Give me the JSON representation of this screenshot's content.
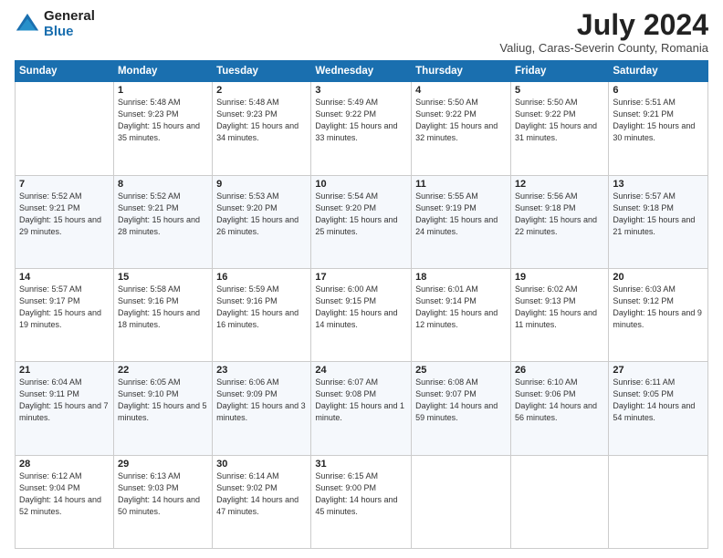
{
  "logo": {
    "general": "General",
    "blue": "Blue"
  },
  "header": {
    "title": "July 2024",
    "subtitle": "Valiug, Caras-Severin County, Romania"
  },
  "weekdays": [
    "Sunday",
    "Monday",
    "Tuesday",
    "Wednesday",
    "Thursday",
    "Friday",
    "Saturday"
  ],
  "weeks": [
    [
      {
        "day": "",
        "sunrise": "",
        "sunset": "",
        "daylight": ""
      },
      {
        "day": "1",
        "sunrise": "Sunrise: 5:48 AM",
        "sunset": "Sunset: 9:23 PM",
        "daylight": "Daylight: 15 hours and 35 minutes."
      },
      {
        "day": "2",
        "sunrise": "Sunrise: 5:48 AM",
        "sunset": "Sunset: 9:23 PM",
        "daylight": "Daylight: 15 hours and 34 minutes."
      },
      {
        "day": "3",
        "sunrise": "Sunrise: 5:49 AM",
        "sunset": "Sunset: 9:22 PM",
        "daylight": "Daylight: 15 hours and 33 minutes."
      },
      {
        "day": "4",
        "sunrise": "Sunrise: 5:50 AM",
        "sunset": "Sunset: 9:22 PM",
        "daylight": "Daylight: 15 hours and 32 minutes."
      },
      {
        "day": "5",
        "sunrise": "Sunrise: 5:50 AM",
        "sunset": "Sunset: 9:22 PM",
        "daylight": "Daylight: 15 hours and 31 minutes."
      },
      {
        "day": "6",
        "sunrise": "Sunrise: 5:51 AM",
        "sunset": "Sunset: 9:21 PM",
        "daylight": "Daylight: 15 hours and 30 minutes."
      }
    ],
    [
      {
        "day": "7",
        "sunrise": "Sunrise: 5:52 AM",
        "sunset": "Sunset: 9:21 PM",
        "daylight": "Daylight: 15 hours and 29 minutes."
      },
      {
        "day": "8",
        "sunrise": "Sunrise: 5:52 AM",
        "sunset": "Sunset: 9:21 PM",
        "daylight": "Daylight: 15 hours and 28 minutes."
      },
      {
        "day": "9",
        "sunrise": "Sunrise: 5:53 AM",
        "sunset": "Sunset: 9:20 PM",
        "daylight": "Daylight: 15 hours and 26 minutes."
      },
      {
        "day": "10",
        "sunrise": "Sunrise: 5:54 AM",
        "sunset": "Sunset: 9:20 PM",
        "daylight": "Daylight: 15 hours and 25 minutes."
      },
      {
        "day": "11",
        "sunrise": "Sunrise: 5:55 AM",
        "sunset": "Sunset: 9:19 PM",
        "daylight": "Daylight: 15 hours and 24 minutes."
      },
      {
        "day": "12",
        "sunrise": "Sunrise: 5:56 AM",
        "sunset": "Sunset: 9:18 PM",
        "daylight": "Daylight: 15 hours and 22 minutes."
      },
      {
        "day": "13",
        "sunrise": "Sunrise: 5:57 AM",
        "sunset": "Sunset: 9:18 PM",
        "daylight": "Daylight: 15 hours and 21 minutes."
      }
    ],
    [
      {
        "day": "14",
        "sunrise": "Sunrise: 5:57 AM",
        "sunset": "Sunset: 9:17 PM",
        "daylight": "Daylight: 15 hours and 19 minutes."
      },
      {
        "day": "15",
        "sunrise": "Sunrise: 5:58 AM",
        "sunset": "Sunset: 9:16 PM",
        "daylight": "Daylight: 15 hours and 18 minutes."
      },
      {
        "day": "16",
        "sunrise": "Sunrise: 5:59 AM",
        "sunset": "Sunset: 9:16 PM",
        "daylight": "Daylight: 15 hours and 16 minutes."
      },
      {
        "day": "17",
        "sunrise": "Sunrise: 6:00 AM",
        "sunset": "Sunset: 9:15 PM",
        "daylight": "Daylight: 15 hours and 14 minutes."
      },
      {
        "day": "18",
        "sunrise": "Sunrise: 6:01 AM",
        "sunset": "Sunset: 9:14 PM",
        "daylight": "Daylight: 15 hours and 12 minutes."
      },
      {
        "day": "19",
        "sunrise": "Sunrise: 6:02 AM",
        "sunset": "Sunset: 9:13 PM",
        "daylight": "Daylight: 15 hours and 11 minutes."
      },
      {
        "day": "20",
        "sunrise": "Sunrise: 6:03 AM",
        "sunset": "Sunset: 9:12 PM",
        "daylight": "Daylight: 15 hours and 9 minutes."
      }
    ],
    [
      {
        "day": "21",
        "sunrise": "Sunrise: 6:04 AM",
        "sunset": "Sunset: 9:11 PM",
        "daylight": "Daylight: 15 hours and 7 minutes."
      },
      {
        "day": "22",
        "sunrise": "Sunrise: 6:05 AM",
        "sunset": "Sunset: 9:10 PM",
        "daylight": "Daylight: 15 hours and 5 minutes."
      },
      {
        "day": "23",
        "sunrise": "Sunrise: 6:06 AM",
        "sunset": "Sunset: 9:09 PM",
        "daylight": "Daylight: 15 hours and 3 minutes."
      },
      {
        "day": "24",
        "sunrise": "Sunrise: 6:07 AM",
        "sunset": "Sunset: 9:08 PM",
        "daylight": "Daylight: 15 hours and 1 minute."
      },
      {
        "day": "25",
        "sunrise": "Sunrise: 6:08 AM",
        "sunset": "Sunset: 9:07 PM",
        "daylight": "Daylight: 14 hours and 59 minutes."
      },
      {
        "day": "26",
        "sunrise": "Sunrise: 6:10 AM",
        "sunset": "Sunset: 9:06 PM",
        "daylight": "Daylight: 14 hours and 56 minutes."
      },
      {
        "day": "27",
        "sunrise": "Sunrise: 6:11 AM",
        "sunset": "Sunset: 9:05 PM",
        "daylight": "Daylight: 14 hours and 54 minutes."
      }
    ],
    [
      {
        "day": "28",
        "sunrise": "Sunrise: 6:12 AM",
        "sunset": "Sunset: 9:04 PM",
        "daylight": "Daylight: 14 hours and 52 minutes."
      },
      {
        "day": "29",
        "sunrise": "Sunrise: 6:13 AM",
        "sunset": "Sunset: 9:03 PM",
        "daylight": "Daylight: 14 hours and 50 minutes."
      },
      {
        "day": "30",
        "sunrise": "Sunrise: 6:14 AM",
        "sunset": "Sunset: 9:02 PM",
        "daylight": "Daylight: 14 hours and 47 minutes."
      },
      {
        "day": "31",
        "sunrise": "Sunrise: 6:15 AM",
        "sunset": "Sunset: 9:00 PM",
        "daylight": "Daylight: 14 hours and 45 minutes."
      },
      {
        "day": "",
        "sunrise": "",
        "sunset": "",
        "daylight": ""
      },
      {
        "day": "",
        "sunrise": "",
        "sunset": "",
        "daylight": ""
      },
      {
        "day": "",
        "sunrise": "",
        "sunset": "",
        "daylight": ""
      }
    ]
  ]
}
